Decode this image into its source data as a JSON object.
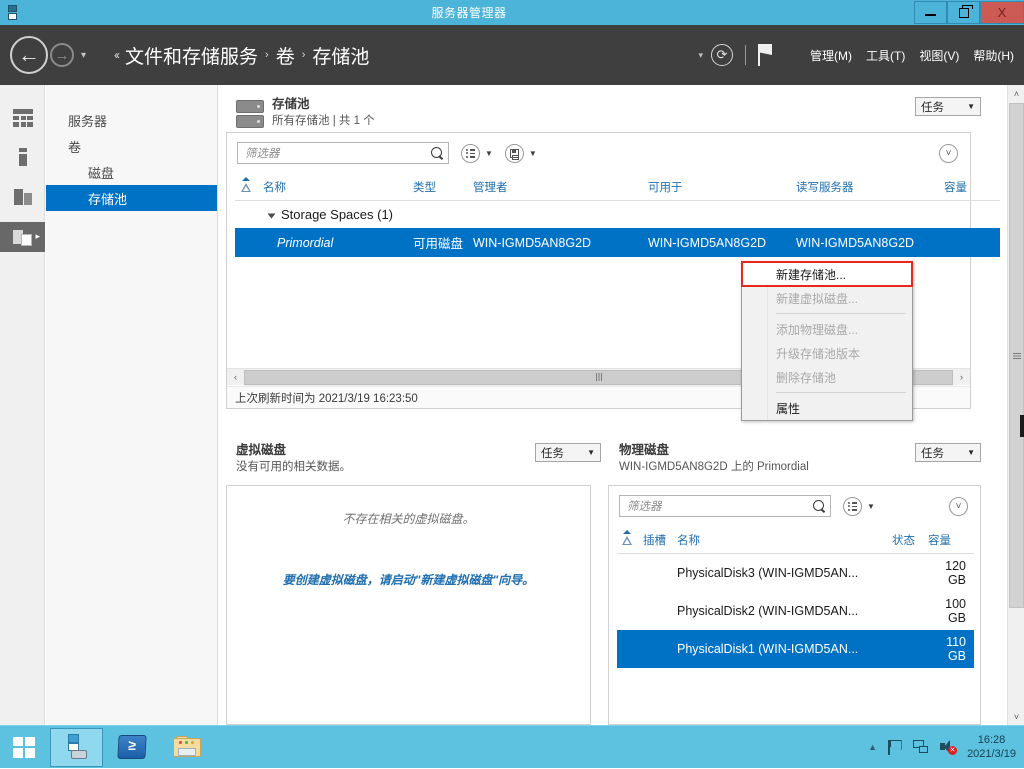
{
  "window": {
    "title": "服务器管理器",
    "icon": "server-manager-icon",
    "controls": {
      "minimize": "−",
      "restore": "❐",
      "close": "X"
    }
  },
  "navbar": {
    "back_icon": "back-arrow-icon",
    "forward_icon": "forward-arrow-icon",
    "dropdown_caret": "▾",
    "breadcrumb_lead": "‹‹",
    "breadcrumb": [
      "文件和存储服务",
      "卷",
      "存储池"
    ],
    "separator": "›",
    "refresh_icon": "refresh-icon",
    "notifications_icon": "flag-icon",
    "menus": [
      "管理(M)",
      "工具(T)",
      "视图(V)",
      "帮助(H)"
    ]
  },
  "icon_rail": [
    {
      "name": "servers-grid-icon"
    },
    {
      "name": "volumes-icon"
    },
    {
      "name": "disks-icon"
    },
    {
      "name": "storage-pools-icon",
      "active": true,
      "caret": "▸"
    }
  ],
  "sidebar": {
    "items": [
      {
        "label": "服务器",
        "selected": false,
        "sub": false
      },
      {
        "label": "卷",
        "selected": false,
        "sub": false
      },
      {
        "label": "磁盘",
        "selected": false,
        "sub": true
      },
      {
        "label": "存储池",
        "selected": true,
        "sub": true
      }
    ]
  },
  "storage_pools_panel": {
    "title": "存储池",
    "subtitle": "所有存储池 | 共 1 个",
    "task_label": "任务",
    "task_caret": "▼",
    "filter_placeholder": "筛选器",
    "search_icon": "search-icon",
    "view_icon": "list-view-icon",
    "save_icon": "save-query-icon",
    "expand_icon": "chevron-down-icon",
    "columns": [
      "名称",
      "类型",
      "管理者",
      "可用于",
      "读写服务器",
      "容量"
    ],
    "warning_column_icon": "warning-icon",
    "group_row": "Storage Spaces (1)",
    "rows": [
      {
        "name": "Primordial",
        "type": "可用磁盘",
        "managed_by": "WIN-IGMD5AN8G2D",
        "available_to": "WIN-IGMD5AN8G2D",
        "read_write_server": "WIN-IGMD5AN8G2D",
        "capacity": "",
        "selected": true
      }
    ],
    "status_text": "上次刷新时间为 2021/3/19 16:23:50",
    "scroll_left_icon": "‹",
    "scroll_right_icon": "›"
  },
  "context_menu": {
    "items": [
      {
        "label": "新建存储池...",
        "enabled": true,
        "highlighted": true
      },
      {
        "label": "新建虚拟磁盘...",
        "enabled": false,
        "highlighted": false
      },
      {
        "separator_after": true
      },
      {
        "label": "添加物理磁盘...",
        "enabled": false,
        "highlighted": false
      },
      {
        "label": "升级存储池版本",
        "enabled": false,
        "highlighted": false
      },
      {
        "label": "删除存储池",
        "enabled": false,
        "highlighted": false
      },
      {
        "separator_after": true
      },
      {
        "label": "属性",
        "enabled": true,
        "highlighted": false
      }
    ],
    "highlight_color": "#e8271d"
  },
  "virtual_disk_panel": {
    "title": "虚拟磁盘",
    "subtitle": "没有可用的相关数据。",
    "task_label": "任务",
    "task_caret": "▼",
    "empty_text": "不存在相关的虚拟磁盘。",
    "action_text": "要创建虚拟磁盘，请启动\"新建虚拟磁盘\"向导。"
  },
  "physical_disk_panel": {
    "title": "物理磁盘",
    "subtitle": "WIN-IGMD5AN8G2D 上的 Primordial",
    "task_label": "任务",
    "task_caret": "▼",
    "filter_placeholder": "筛选器",
    "search_icon": "search-icon",
    "view_icon": "list-view-icon",
    "expand_icon": "chevron-down-icon",
    "columns": [
      "插槽",
      "名称",
      "状态",
      "容量"
    ],
    "warning_column_icon": "warning-icon",
    "rows": [
      {
        "slot": "",
        "name": "PhysicalDisk3 (WIN-IGMD5AN...",
        "status": "",
        "capacity": "120 GB",
        "selected": false
      },
      {
        "slot": "",
        "name": "PhysicalDisk2 (WIN-IGMD5AN...",
        "status": "",
        "capacity": "100 GB",
        "selected": false
      },
      {
        "slot": "",
        "name": "PhysicalDisk1 (WIN-IGMD5AN...",
        "status": "",
        "capacity": "110 GB",
        "selected": true
      }
    ]
  },
  "vertical_scrollbar": {
    "up_icon": "˄",
    "down_icon": "˅"
  },
  "taskbar": {
    "start_icon": "windows-start-icon",
    "apps": [
      {
        "name": "server-manager-taskbar-icon",
        "active": true
      },
      {
        "name": "powershell-taskbar-icon",
        "label": "≥",
        "active": false
      },
      {
        "name": "file-explorer-taskbar-icon",
        "active": false
      }
    ],
    "tray": {
      "show_hidden_icon": "▲",
      "flag_icon": "action-center-flag-icon",
      "network_icon": "network-icon",
      "volume_icon": "volume-muted-icon",
      "time": "16:28",
      "date": "2021/3/19"
    }
  },
  "colors": {
    "accent_blue": "#0072c6",
    "title_bar": "#4cb3d9",
    "nav_dark": "#3f3f3f",
    "link_blue": "#1f6fb0",
    "highlight_red": "#e8271d"
  }
}
